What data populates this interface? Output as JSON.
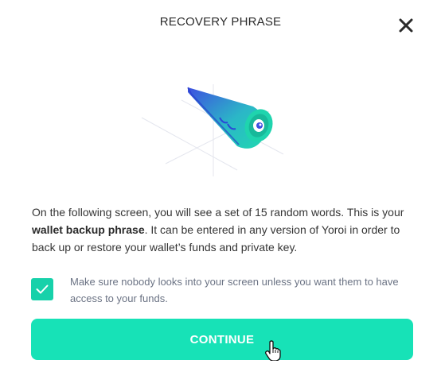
{
  "dialog": {
    "title": "RECOVERY PHRASE",
    "close_icon": "close-icon",
    "illustration_icon": "recovery-phrase-illustration"
  },
  "content": {
    "paragraph_part1": "On the following screen, you will see a set of 15 random words. This is your ",
    "paragraph_bold": "wallet backup phrase",
    "paragraph_part2": ". It can be entered in any version of Yoroi in order to back up or restore your wallet’s funds and private key."
  },
  "acknowledge": {
    "checked": true,
    "label": "Make sure nobody looks into your screen unless you want them to have access to your funds."
  },
  "actions": {
    "continue_label": "CONTINUE"
  },
  "colors": {
    "accent": "#17e2b7",
    "checkbox": "#17d1aa",
    "text": "#353535",
    "muted_text": "#6b7384"
  }
}
